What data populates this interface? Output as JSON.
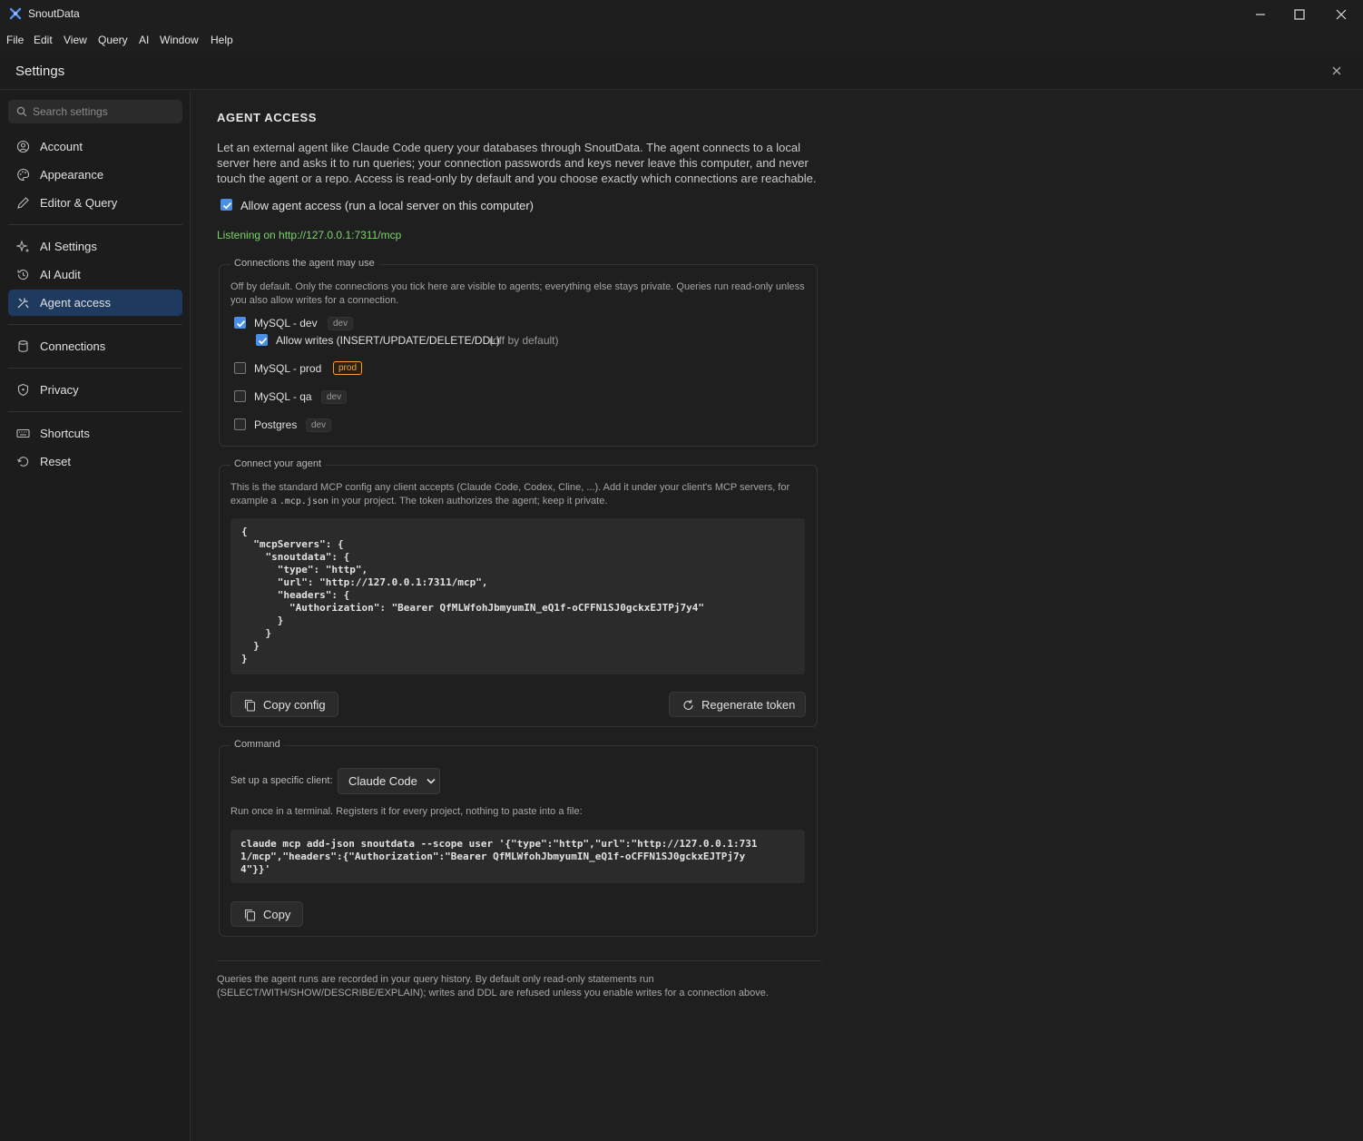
{
  "window": {
    "title": "SnoutData",
    "menu": [
      "File",
      "Edit",
      "View",
      "Query",
      "AI",
      "Window",
      "Help"
    ]
  },
  "settings": {
    "title": "Settings"
  },
  "sidebar": {
    "search_placeholder": "Search settings",
    "items": [
      {
        "label": "Account",
        "icon": "account-icon",
        "active": false
      },
      {
        "label": "Appearance",
        "icon": "palette-icon",
        "active": false
      },
      {
        "label": "Editor & Query",
        "icon": "pencil-icon",
        "active": false
      },
      {
        "label": "AI Settings",
        "icon": "sparkles-icon",
        "active": false
      },
      {
        "label": "AI Audit",
        "icon": "history-icon",
        "active": false
      },
      {
        "label": "Agent access",
        "icon": "agent-icon",
        "active": true
      },
      {
        "label": "Connections",
        "icon": "database-icon",
        "active": false
      },
      {
        "label": "Privacy",
        "icon": "shield-icon",
        "active": false
      },
      {
        "label": "Shortcuts",
        "icon": "keyboard-icon",
        "active": false
      },
      {
        "label": "Reset",
        "icon": "reset-icon",
        "active": false
      }
    ]
  },
  "main": {
    "title": "AGENT ACCESS",
    "intro": "Let an external agent like Claude Code query your databases through SnoutData. The agent connects to a local server here and asks it to run queries; your connection passwords and keys never leave this computer, and never touch the agent or a repo. Access is read-only by default and you choose exactly which connections are reachable.",
    "allow_access": {
      "label": "Allow agent access (run a local server on this computer)",
      "checked": true
    },
    "listening": "Listening on http://127.0.0.1:7311/mcp",
    "connections_group": {
      "legend": "Connections the agent may use",
      "note": "Off by default. Only the connections you tick here are visible to agents; everything else stays private. Queries run read-only unless you also allow writes for a connection.",
      "items": [
        {
          "name": "MySQL - dev",
          "tag": "dev",
          "checked": true
        },
        {
          "name": "MySQL - prod",
          "tag": "prod",
          "checked": false
        },
        {
          "name": "MySQL - qa",
          "tag": "dev",
          "checked": false
        },
        {
          "name": "Postgres",
          "tag": "dev",
          "checked": false
        }
      ],
      "allow_writes": {
        "label": "Allow writes (INSERT/UPDATE/DELETE/DDL)",
        "hint": "(off by default)",
        "checked": true
      }
    },
    "connect_group": {
      "legend": "Connect your agent",
      "note_a": "This is the standard MCP config any client accepts (Claude Code, Codex, Cline, ...). Add it under your client's MCP servers, for",
      "note_b_pre": "example a",
      "note_b_code": ".mcp.json",
      "note_b_post": "in your project. The token authorizes the agent; keep it private.",
      "config": "{\n  \"mcpServers\": {\n    \"snoutdata\": {\n      \"type\": \"http\",\n      \"url\": \"http://127.0.0.1:7311/mcp\",\n      \"headers\": {\n        \"Authorization\": \"Bearer QfMLWfohJbmyumIN_eQ1f-oCFFN1SJ0gckxEJTPj7y4\"\n      }\n    }\n  }\n}",
      "copy_label": "Copy config",
      "regen_label": "Regenerate token"
    },
    "command_group": {
      "legend": "Command",
      "client_label": "Set up a specific client:",
      "client_value": "Claude Code",
      "run_note": "Run once in a terminal. Registers it for every project, nothing to paste into a file:",
      "command": "claude mcp add-json snoutdata --scope user '{\"type\":\"http\",\"url\":\"http://127.0.0.1:731\n1/mcp\",\"headers\":{\"Authorization\":\"Bearer QfMLWfohJbmyumIN_eQ1f-oCFFN1SJ0gckxEJTPj7y\n4\"}}'",
      "copy_label": "Copy"
    },
    "footer": "Queries the agent runs are recorded in your query history. By default only read-only statements run (SELECT/WITH/SHOW/DESCRIBE/EXPLAIN); writes and DDL are refused unless you enable writes for a connection above."
  },
  "colors": {
    "accent": "#4a8fe7",
    "active_nav": "#1e3a5f",
    "listening": "#7bd56b",
    "prod": "#f0a13c"
  }
}
